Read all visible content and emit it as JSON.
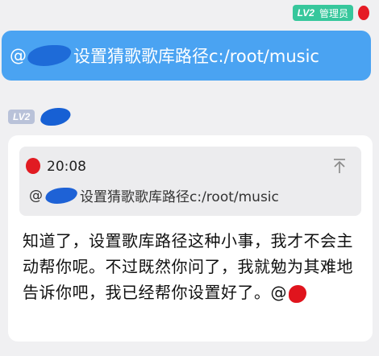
{
  "admin": {
    "level": "LV2",
    "role": "管理员"
  },
  "user_message": {
    "mention": "@",
    "text": "设置猜歌歌库路径c:/root/music"
  },
  "bot": {
    "level": "LV2"
  },
  "reply": {
    "quote": {
      "time": "20:08",
      "mention": "@",
      "text": "设置猜歌歌库路径c:/root/music"
    },
    "text": "知道了，设置歌库路径这种小事，我才不会主动帮你呢。不过既然你问了，我就勉为其难地告诉你吧，我已经帮你设置好了。@"
  }
}
